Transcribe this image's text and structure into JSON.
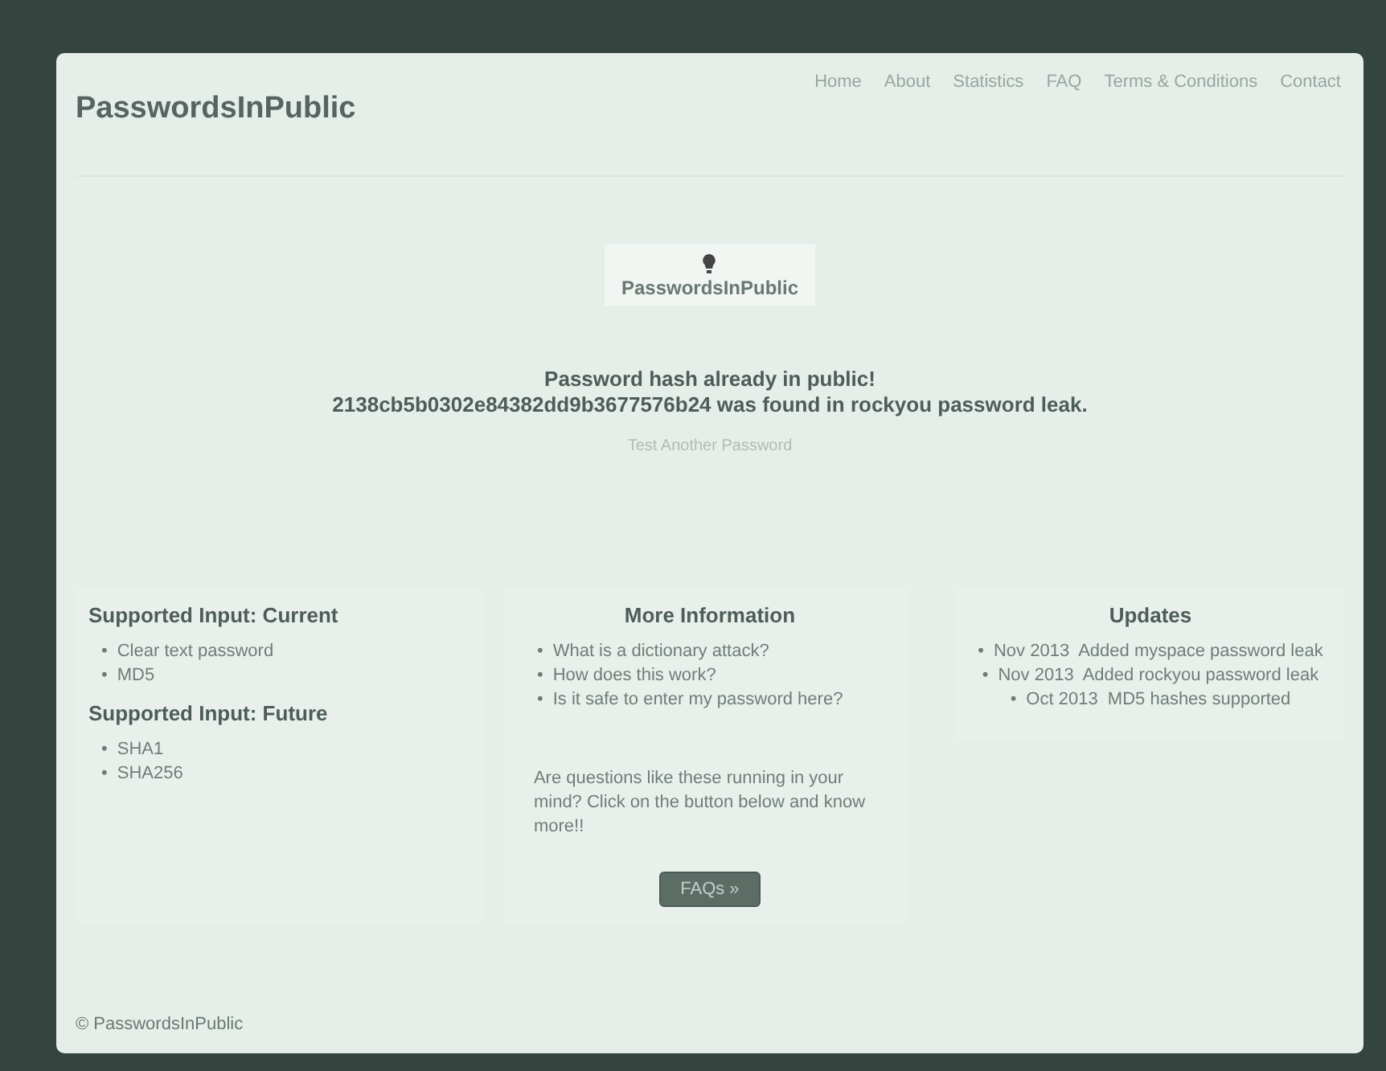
{
  "header": {
    "brand": "PasswordsInPublic",
    "nav": [
      "Home",
      "About",
      "Statistics",
      "FAQ",
      "Terms & Conditions",
      "Contact"
    ]
  },
  "logo": {
    "text": "PasswordsInPublic"
  },
  "result": {
    "title": "Password hash already in public!",
    "message": "2138cb5b0302e84382dd9b3677576b24 was found in rockyou password leak.",
    "link": "Test Another Password"
  },
  "supported": [
    {
      "heading": "Supported Input: Current",
      "items": [
        "Clear text password",
        "MD5"
      ]
    },
    {
      "heading": "Supported Input: Future",
      "items": [
        "SHA1",
        "SHA256"
      ]
    }
  ],
  "more_info": {
    "heading": "More Information",
    "questions": [
      "What is a dictionary attack?",
      "How does this work?",
      "Is it safe to enter my password here?"
    ],
    "text": "Are questions like these running in your mind? Click on the button below and know more!!",
    "button": "FAQs »"
  },
  "updates": {
    "heading": "Updates",
    "items": [
      "Nov 2013  Added myspace password leak",
      "Nov 2013  Added rockyou password leak",
      "Oct 2013  MD5 hashes supported"
    ]
  },
  "bullet": "•",
  "footer": "© PasswordsInPublic"
}
